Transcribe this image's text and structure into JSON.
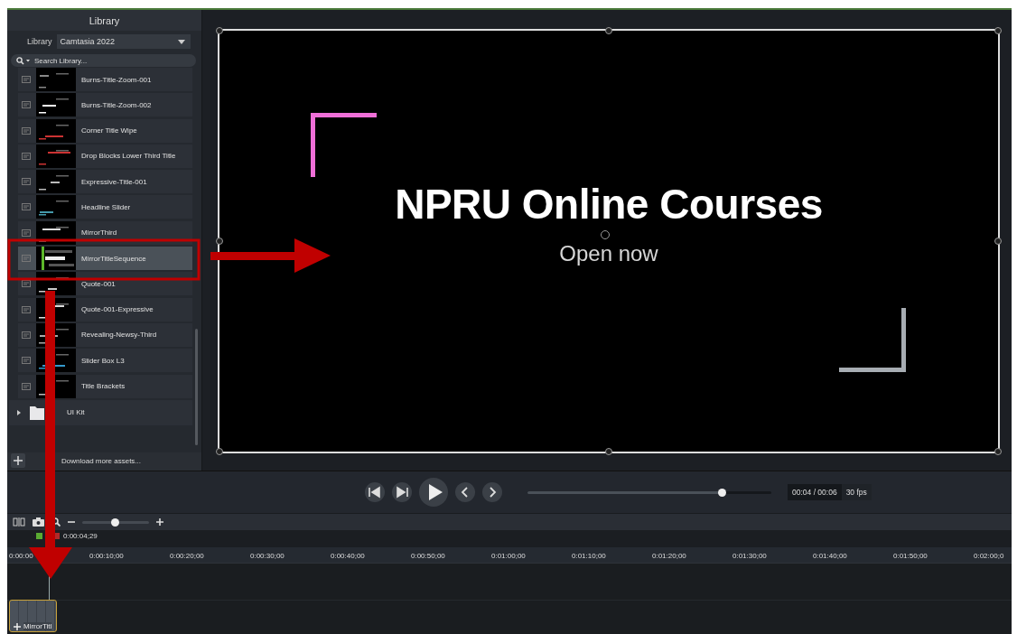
{
  "library": {
    "title": "Library",
    "selector_label": "Library",
    "selector_value": "Camtasia 2022",
    "search": {
      "placeholder": "Search Library..."
    },
    "items": [
      {
        "name": "Burns-Title-Zoom-001",
        "selected": false
      },
      {
        "name": "Burns-Title-Zoom-002",
        "selected": false
      },
      {
        "name": "Corner Title Wipe",
        "selected": false
      },
      {
        "name": "Drop Blocks Lower Third Title",
        "selected": false
      },
      {
        "name": "Expressive-Title-001",
        "selected": false
      },
      {
        "name": "Headline Slider",
        "selected": false
      },
      {
        "name": "MirrorThird",
        "selected": false
      },
      {
        "name": "MirrorTitleSequence",
        "selected": true
      },
      {
        "name": "Quote-001",
        "selected": false
      },
      {
        "name": "Quote-001-Expressive",
        "selected": false
      },
      {
        "name": "Revealing-Newsy-Third",
        "selected": false
      },
      {
        "name": "Slider Box L3",
        "selected": false
      },
      {
        "name": "Title Brackets",
        "selected": false
      }
    ],
    "folders": [
      {
        "name": "UI Kit",
        "expanded": false
      }
    ],
    "download_link": "Download more assets..."
  },
  "preview": {
    "title": "NPRU Online Courses",
    "subtitle": "Open now"
  },
  "playback": {
    "scrubber": {
      "level": 0.8
    },
    "time": "00:04 / 00:06",
    "fps": "30 fps"
  },
  "timeline": {
    "zoom": {
      "level": 0.5
    },
    "playhead_time": "0:00:04;29",
    "ruler_labels": [
      "0:00:00",
      "0:00:10;00",
      "0:00:20;00",
      "0:00:30;00",
      "0:00:40;00",
      "0:00:50;00",
      "0:01:00;00",
      "0:01:10;00",
      "0:01:20;00",
      "0:01:30;00",
      "0:01:40;00",
      "0:01:50;00",
      "0:02:00;0"
    ],
    "clip": {
      "label": "MirrorTitl"
    }
  }
}
